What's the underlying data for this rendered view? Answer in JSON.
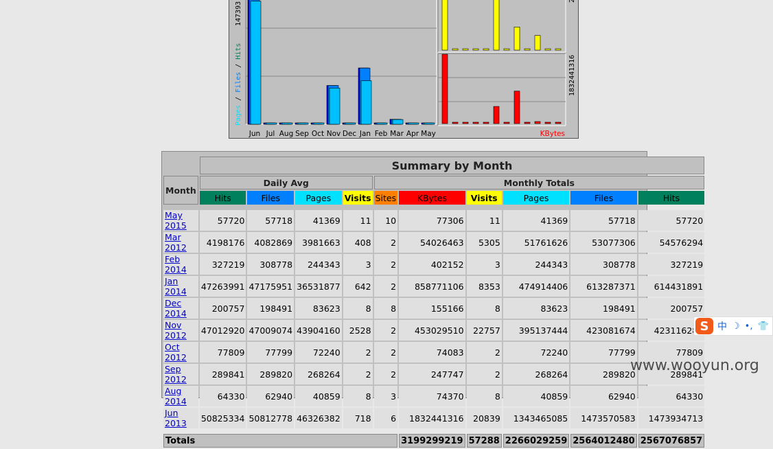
{
  "chart_data": [
    {
      "type": "bar",
      "title": "",
      "categories": [
        "Jun",
        "Jul",
        "Aug",
        "Sep",
        "Oct",
        "Nov",
        "Dec",
        "Jan",
        "Feb",
        "Mar",
        "Apr",
        "May"
      ],
      "ylabel_parts": [
        "Pages",
        "/",
        "Files",
        "/",
        "Hits"
      ],
      "ytick_label": "147393",
      "series": [
        {
          "name": "Hits",
          "values": [
            1473934713,
            0,
            64330,
            289841,
            77809,
            423116283,
            200757,
            614431891,
            327219,
            54576294,
            0,
            57720
          ]
        },
        {
          "name": "Files",
          "values": [
            1473570583,
            0,
            62940,
            289820,
            77799,
            423081674,
            198491,
            613287371,
            308778,
            53077306,
            0,
            57718
          ]
        },
        {
          "name": "Pages",
          "values": [
            1343465085,
            0,
            40859,
            268264,
            72240,
            395137444,
            83623,
            474914406,
            244343,
            51761626,
            0,
            41369
          ]
        }
      ]
    },
    {
      "type": "bar",
      "title": "",
      "categories": [
        "Jun",
        "Jul",
        "Aug",
        "Sep",
        "Oct",
        "Nov",
        "Dec",
        "Jan",
        "Feb",
        "Mar",
        "Apr",
        "May"
      ],
      "series": [
        {
          "name": "Visits",
          "values": [
            20839,
            0,
            8,
            2,
            2,
            22757,
            8,
            8353,
            3,
            5305,
            0,
            11
          ]
        }
      ],
      "ytick_label": "2"
    },
    {
      "type": "bar",
      "title": "",
      "categories": [
        "Jun",
        "Jul",
        "Aug",
        "Sep",
        "Oct",
        "Nov",
        "Dec",
        "Jan",
        "Feb",
        "Mar",
        "Apr",
        "May"
      ],
      "series": [
        {
          "name": "KBytes",
          "values": [
            1832441316,
            0,
            74370,
            247747,
            74083,
            453029510,
            155166,
            858771106,
            402152,
            54026463,
            0,
            77306
          ]
        }
      ],
      "ytick_label": "1832441316",
      "legend_label": "KBytes"
    }
  ],
  "colors": {
    "hits": "#00805c",
    "files": "#0080ff",
    "pages": "#00e0ff",
    "visits": "#ffff00",
    "sites": "#ff8000",
    "kbytes": "#ff0000",
    "bar_hits_chart": "#0000ff",
    "bar_files_chart": "#0080ff",
    "bar_pages_chart": "#00c0ff"
  },
  "summary": {
    "title": "Summary by Month",
    "month_label": "Month",
    "daily_avg_label": "Daily Avg",
    "monthly_totals_label": "Monthly Totals",
    "daily_cols": [
      "Hits",
      "Files",
      "Pages",
      "Visits"
    ],
    "monthly_cols": [
      "Sites",
      "KBytes",
      "Visits",
      "Pages",
      "Files",
      "Hits"
    ],
    "rows": [
      {
        "month": "May 2015",
        "d_hits": "57720",
        "d_files": "57718",
        "d_pages": "41369",
        "d_visits": "11",
        "sites": "10",
        "kbytes": "77306",
        "visits": "11",
        "pages": "41369",
        "files": "57718",
        "hits": "57720"
      },
      {
        "month": "Mar 2012",
        "d_hits": "4198176",
        "d_files": "4082869",
        "d_pages": "3981663",
        "d_visits": "408",
        "sites": "2",
        "kbytes": "54026463",
        "visits": "5305",
        "pages": "51761626",
        "files": "53077306",
        "hits": "54576294"
      },
      {
        "month": "Feb 2014",
        "d_hits": "327219",
        "d_files": "308778",
        "d_pages": "244343",
        "d_visits": "3",
        "sites": "2",
        "kbytes": "402152",
        "visits": "3",
        "pages": "244343",
        "files": "308778",
        "hits": "327219"
      },
      {
        "month": "Jan 2014",
        "d_hits": "47263991",
        "d_files": "47175951",
        "d_pages": "36531877",
        "d_visits": "642",
        "sites": "2",
        "kbytes": "858771106",
        "visits": "8353",
        "pages": "474914406",
        "files": "613287371",
        "hits": "614431891"
      },
      {
        "month": "Dec 2014",
        "d_hits": "200757",
        "d_files": "198491",
        "d_pages": "83623",
        "d_visits": "8",
        "sites": "8",
        "kbytes": "155166",
        "visits": "8",
        "pages": "83623",
        "files": "198491",
        "hits": "200757"
      },
      {
        "month": "Nov 2012",
        "d_hits": "47012920",
        "d_files": "47009074",
        "d_pages": "43904160",
        "d_visits": "2528",
        "sites": "2",
        "kbytes": "453029510",
        "visits": "22757",
        "pages": "395137444",
        "files": "423081674",
        "hits": "423116283"
      },
      {
        "month": "Oct 2012",
        "d_hits": "77809",
        "d_files": "77799",
        "d_pages": "72240",
        "d_visits": "2",
        "sites": "2",
        "kbytes": "74083",
        "visits": "2",
        "pages": "72240",
        "files": "77799",
        "hits": "77809"
      },
      {
        "month": "Sep 2012",
        "d_hits": "289841",
        "d_files": "289820",
        "d_pages": "268264",
        "d_visits": "2",
        "sites": "2",
        "kbytes": "247747",
        "visits": "2",
        "pages": "268264",
        "files": "289820",
        "hits": "289841"
      },
      {
        "month": "Aug 2014",
        "d_hits": "64330",
        "d_files": "62940",
        "d_pages": "40859",
        "d_visits": "8",
        "sites": "3",
        "kbytes": "74370",
        "visits": "8",
        "pages": "40859",
        "files": "62940",
        "hits": "64330"
      },
      {
        "month": "Jun 2013",
        "d_hits": "50825334",
        "d_files": "50812778",
        "d_pages": "46326382",
        "d_visits": "718",
        "sites": "6",
        "kbytes": "1832441316",
        "visits": "20839",
        "pages": "1343465085",
        "files": "1473570583",
        "hits": "1473934713"
      }
    ],
    "totals": {
      "label": "Totals",
      "kbytes": "3199299219",
      "visits": "57288",
      "pages": "2266029259",
      "files": "2564012480",
      "hits": "2567076857"
    }
  },
  "ime": {
    "lang": "中",
    "logo": "S"
  },
  "watermark": "www.wooyun.org"
}
